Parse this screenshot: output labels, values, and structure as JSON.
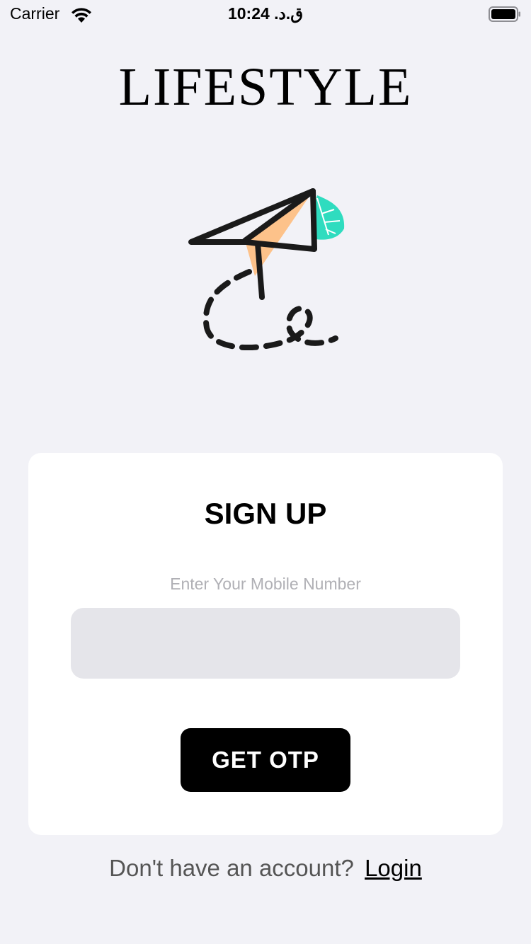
{
  "status_bar": {
    "carrier": "Carrier",
    "time": "ق.د. 10:24",
    "icons": [
      "wifi-icon",
      "battery-icon"
    ]
  },
  "app": {
    "title": "LIFESTYLE"
  },
  "illustration": {
    "icon": "paper-plane-illustration",
    "colors": {
      "stroke": "#1a1a1a",
      "plane_fill": "#fdc28a",
      "leaf": "#2fdcbf"
    }
  },
  "signup_card": {
    "title": "SIGN UP",
    "mobile_label": "Enter Your Mobile Number",
    "mobile_value": "",
    "mobile_placeholder": "",
    "button_label": "GET OTP"
  },
  "footer": {
    "prompt": "Don't have an account?",
    "login_link": "Login"
  },
  "colors": {
    "background": "#f2f2f7",
    "card": "#ffffff",
    "input": "#e5e5ea",
    "button": "#000000",
    "button_text": "#ffffff",
    "label": "#b0b0b5"
  }
}
